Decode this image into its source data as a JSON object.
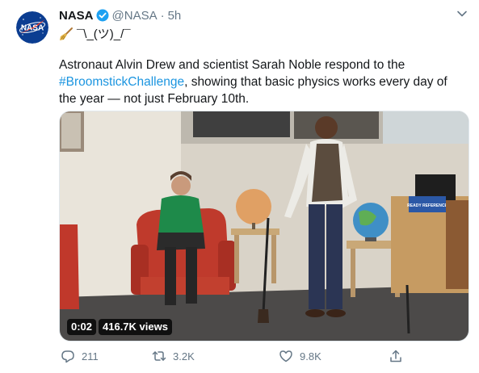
{
  "tweet": {
    "display_name": "NASA",
    "handle": "@NASA",
    "separator": "·",
    "time": "5h",
    "avatar_text": "NASA",
    "emoji_line": "¯\\_(ツ)_/¯",
    "text_before": "Astronaut Alvin Drew and scientist Sarah Noble respond to the ",
    "hashtag": "#BroomstickChallenge",
    "text_after": ", showing that basic physics works every day of the year — not just February 10th."
  },
  "media": {
    "duration": "0:02",
    "views": "416.7K views",
    "sign_text": "READY REFERENCE"
  },
  "actions": {
    "replies": "211",
    "retweets": "3.2K",
    "likes": "9.8K"
  },
  "colors": {
    "link": "#1b95e0",
    "muted": "#657786",
    "verified": "#1da1f2",
    "nasa_blue": "#0b3d91",
    "nasa_red": "#fc3d21"
  },
  "icons": [
    "nasa-logo-icon",
    "verified-badge-icon",
    "chevron-down-icon",
    "broom-icon",
    "reply-icon",
    "retweet-icon",
    "like-icon",
    "share-icon"
  ]
}
